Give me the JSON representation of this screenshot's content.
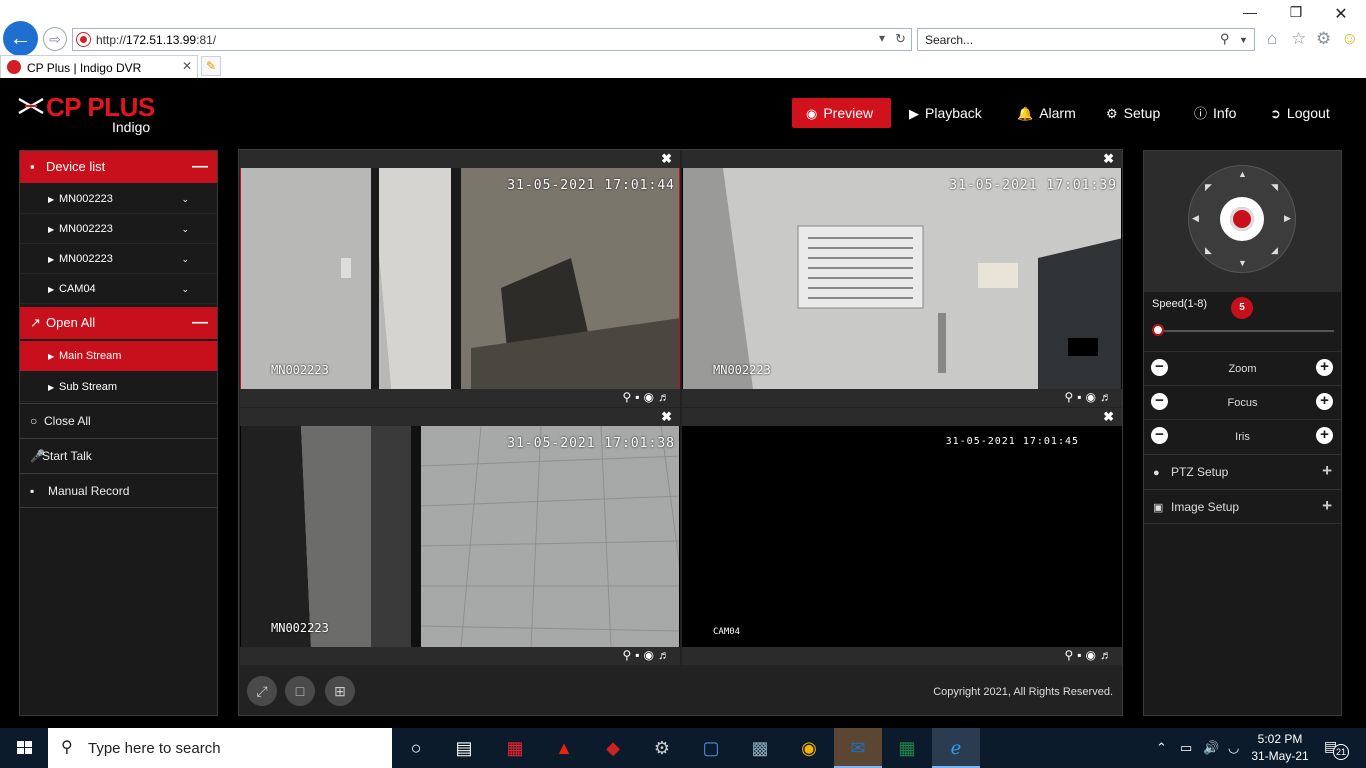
{
  "browser": {
    "url_prefix": "http://",
    "url_host": "172.51.13.99",
    "url_suffix": ":81/",
    "search_placeholder": "Search...",
    "tab_title": "CP Plus | Indigo DVR"
  },
  "app": {
    "brand": "CP PLUS",
    "sub": "Indigo",
    "accent": "#c8101c",
    "nav": [
      {
        "label": "Preview",
        "icon": "eye-icon",
        "active": true
      },
      {
        "label": "Playback",
        "icon": "play-circle-icon"
      },
      {
        "label": "Alarm",
        "icon": "bell-icon"
      },
      {
        "label": "Setup",
        "icon": "gear-icon"
      },
      {
        "label": "Info",
        "icon": "info-icon"
      },
      {
        "label": "Logout",
        "icon": "logout-icon"
      }
    ]
  },
  "left": {
    "device_list_label": "Device list",
    "devices": [
      "MN002223",
      "MN002223",
      "MN002223",
      "CAM04"
    ],
    "open_all_label": "Open All",
    "streams": [
      {
        "label": "Main Stream",
        "selected": true
      },
      {
        "label": "Sub Stream",
        "selected": false
      }
    ],
    "close_all_label": "Close All",
    "start_talk_label": "Start Talk",
    "manual_record_label": "Manual Record"
  },
  "video": {
    "cells": [
      {
        "timestamp": "31-05-2021 17:01:44",
        "channel": "MN002223",
        "selected": true
      },
      {
        "timestamp": "31-05-2021 17:01:39",
        "channel": "MN002223",
        "selected": false
      },
      {
        "timestamp": "31-05-2021 17:01:38",
        "channel": "MN002223",
        "selected": false
      },
      {
        "timestamp": "31-05-2021 17:01:45",
        "channel": "CAM04",
        "selected": false
      }
    ],
    "copyright": "Copyright 2021, All Rights Reserved."
  },
  "ptz": {
    "speed_label": "Speed(1-8)",
    "speed_value": "5",
    "speed_min": 1,
    "speed_max": 8,
    "zoom_label": "Zoom",
    "focus_label": "Focus",
    "iris_label": "Iris",
    "ptz_setup_label": "PTZ Setup",
    "image_setup_label": "Image Setup"
  },
  "taskbar": {
    "search_placeholder": "Type here to search",
    "time": "5:02 PM",
    "date": "31-May-21",
    "notifications": "21"
  }
}
